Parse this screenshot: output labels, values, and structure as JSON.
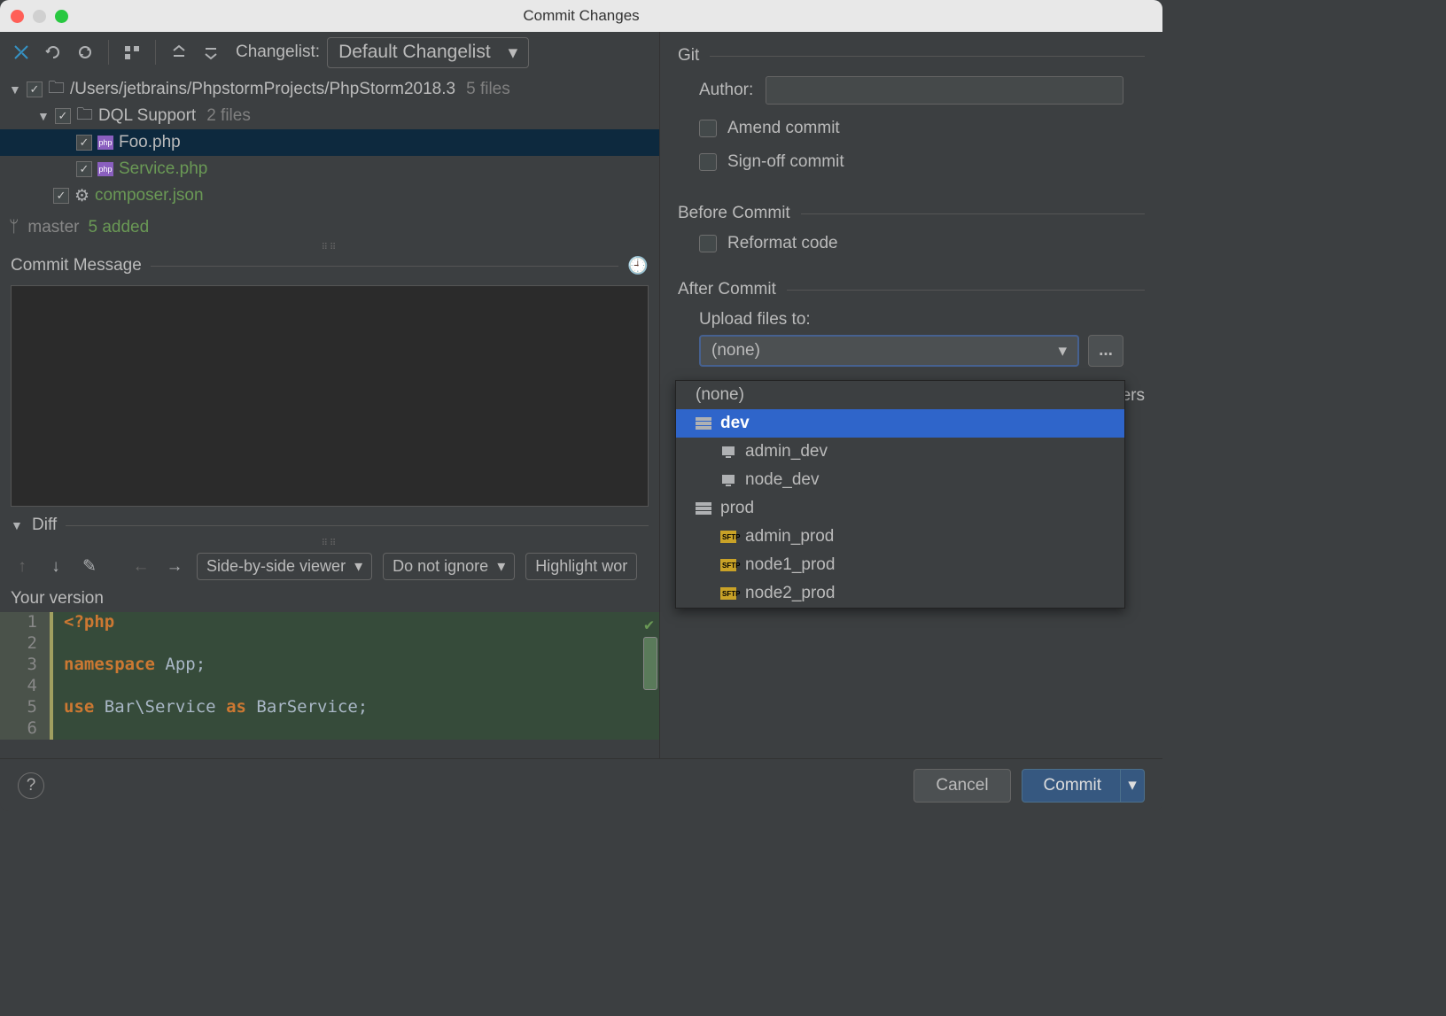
{
  "window": {
    "title": "Commit Changes"
  },
  "toolbar": {
    "changelist_label": "Changelist:",
    "changelist_value": "Default Changelist"
  },
  "tree": {
    "root": {
      "path": "/Users/jetbrains/PhpstormProjects/PhpStorm2018.3",
      "meta": "5 files"
    },
    "folder": {
      "name": "DQL Support",
      "meta": "2 files"
    },
    "files": [
      {
        "name": "Foo.php"
      },
      {
        "name": "Service.php"
      },
      {
        "name": "composer.json"
      }
    ]
  },
  "branch": {
    "name": "master",
    "added": "5 added"
  },
  "sections": {
    "commit_message": "Commit Message",
    "diff": "Diff",
    "your_version": "Your version"
  },
  "diff": {
    "viewer": "Side-by-side viewer",
    "ignore": "Do not ignore",
    "highlight": "Highlight wor"
  },
  "code": {
    "lines": [
      {
        "n": "1",
        "html": "<?php"
      },
      {
        "n": "2",
        "html": ""
      },
      {
        "n": "3",
        "html": "namespace App;"
      },
      {
        "n": "4",
        "html": ""
      },
      {
        "n": "5",
        "html": "use Bar\\Service as BarService;"
      },
      {
        "n": "6",
        "html": ""
      }
    ]
  },
  "right": {
    "git_label": "Git",
    "author_label": "Author:",
    "amend_label": "Amend commit",
    "signoff_label": "Sign-off commit",
    "before_label": "Before Commit",
    "reformat_label": "Reformat code",
    "after_label": "After Commit",
    "upload_label": "Upload files to:",
    "upload_value": "(none)",
    "servers_text": "rvers",
    "dropdown": [
      {
        "label": "(none)",
        "indent": 0,
        "icon": ""
      },
      {
        "label": "dev",
        "indent": 0,
        "icon": "group",
        "selected": true
      },
      {
        "label": "admin_dev",
        "indent": 1,
        "icon": "server"
      },
      {
        "label": "node_dev",
        "indent": 1,
        "icon": "server"
      },
      {
        "label": "prod",
        "indent": 0,
        "icon": "group"
      },
      {
        "label": "admin_prod",
        "indent": 1,
        "icon": "sftp"
      },
      {
        "label": "node1_prod",
        "indent": 1,
        "icon": "sftp"
      },
      {
        "label": "node2_prod",
        "indent": 1,
        "icon": "sftp"
      }
    ]
  },
  "footer": {
    "help": "?",
    "cancel": "Cancel",
    "commit": "Commit"
  }
}
